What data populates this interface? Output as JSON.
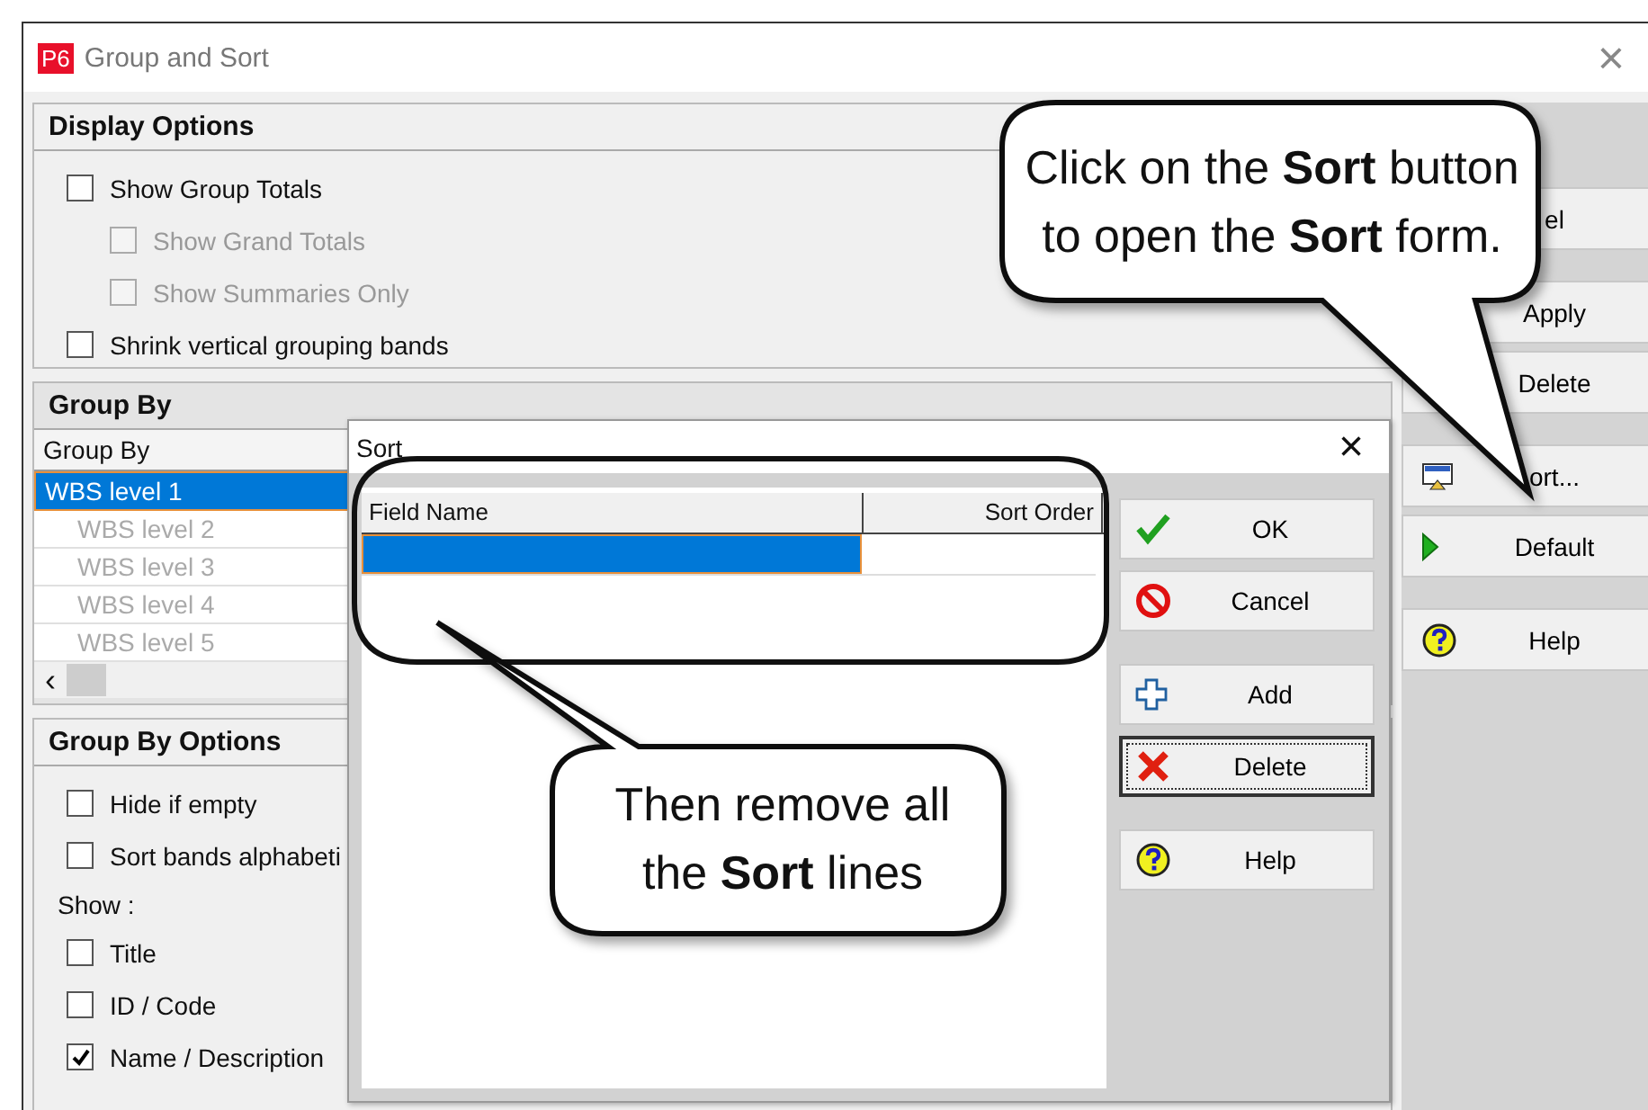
{
  "window": {
    "badge": "P6",
    "title": "Group and Sort"
  },
  "display_options": {
    "title": "Display Options",
    "options": [
      {
        "label": "Show Group Totals",
        "checked": false,
        "disabled": false,
        "children": [
          {
            "label": "Show Grand Totals",
            "checked": false,
            "disabled": true
          },
          {
            "label": "Show Summaries Only",
            "checked": false,
            "disabled": true
          }
        ]
      },
      {
        "label": "Shrink vertical grouping bands",
        "checked": false,
        "disabled": false
      }
    ]
  },
  "group_by": {
    "title": "Group By",
    "column": "Group By",
    "rows": [
      {
        "label": "WBS level 1",
        "selected": true,
        "disabled": false
      },
      {
        "label": "WBS level 2",
        "selected": false,
        "disabled": true
      },
      {
        "label": "WBS level 3",
        "selected": false,
        "disabled": true
      },
      {
        "label": "WBS level 4",
        "selected": false,
        "disabled": true
      },
      {
        "label": "WBS level 5",
        "selected": false,
        "disabled": true
      }
    ],
    "scroll_arrow": "‹"
  },
  "group_by_options": {
    "title": "Group By Options",
    "options": [
      {
        "label": "Hide if empty",
        "checked": false
      },
      {
        "label": "Sort bands alphabeti",
        "checked": false
      }
    ],
    "show_label": "Show :",
    "show_options": [
      {
        "label": "Title",
        "checked": false
      },
      {
        "label": "ID / Code",
        "checked": false
      },
      {
        "label": "Name / Description",
        "checked": true
      }
    ]
  },
  "side_button_groups": [
    [
      {
        "label": "el",
        "kind": "plain"
      }
    ],
    [
      {
        "label": "Apply",
        "kind": "plain"
      },
      {
        "label": "Delete",
        "kind": "plain"
      }
    ],
    [
      {
        "label": "ort...",
        "kind": "screen"
      },
      {
        "label": "Default",
        "kind": "play"
      }
    ],
    [
      {
        "label": "Help",
        "kind": "help"
      }
    ]
  ],
  "sort_dialog": {
    "title": "Sort",
    "close": "×",
    "columns": [
      "Field Name",
      "Sort Order"
    ],
    "rows": [
      {
        "selected": true
      }
    ],
    "button_groups": [
      [
        {
          "label": "OK",
          "kind": "check",
          "focused": false
        },
        {
          "label": "Cancel",
          "kind": "cancel",
          "focused": false
        }
      ],
      [
        {
          "label": "Add",
          "kind": "plus",
          "focused": false
        },
        {
          "label": "Delete",
          "kind": "delete",
          "focused": true
        }
      ],
      [
        {
          "label": "Help",
          "kind": "help",
          "focused": false
        }
      ]
    ]
  },
  "window_close": "×",
  "callouts": [
    {
      "text": "Click on the **Sort** button to open the **Sort** form."
    },
    {
      "text": "Then remove all the **Sort** lines"
    }
  ]
}
